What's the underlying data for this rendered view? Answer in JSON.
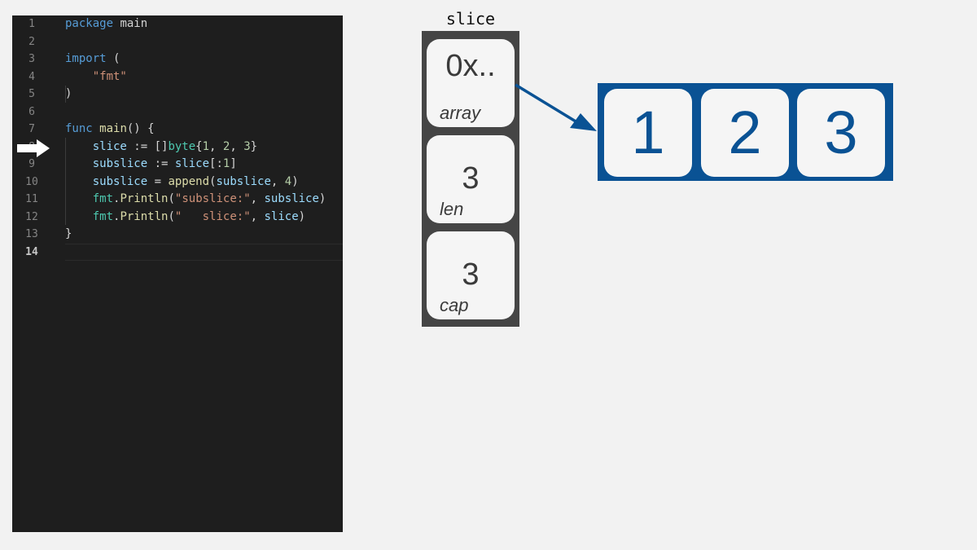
{
  "editor": {
    "current_line": 8,
    "lines": [
      {
        "n": "1",
        "tokens": [
          {
            "t": "package",
            "c": "kw"
          },
          {
            "t": " main",
            "c": "pc"
          }
        ]
      },
      {
        "n": "2",
        "tokens": []
      },
      {
        "n": "3",
        "tokens": [
          {
            "t": "import",
            "c": "kw"
          },
          {
            "t": " (",
            "c": "pc"
          }
        ]
      },
      {
        "n": "4",
        "tokens": [
          {
            "t": "    ",
            "c": "pc"
          },
          {
            "t": "\"fmt\"",
            "c": "str"
          }
        ]
      },
      {
        "n": "5",
        "tokens": [
          {
            "t": ")",
            "c": "pc"
          }
        ]
      },
      {
        "n": "6",
        "tokens": []
      },
      {
        "n": "7",
        "tokens": [
          {
            "t": "func",
            "c": "kw"
          },
          {
            "t": " ",
            "c": "pc"
          },
          {
            "t": "main",
            "c": "fn"
          },
          {
            "t": "() {",
            "c": "pc"
          }
        ]
      },
      {
        "n": "8",
        "tokens": [
          {
            "t": "    ",
            "c": "pc"
          },
          {
            "t": "slice",
            "c": "id"
          },
          {
            "t": " := []",
            "c": "pc"
          },
          {
            "t": "byte",
            "c": "ty"
          },
          {
            "t": "{",
            "c": "pc"
          },
          {
            "t": "1",
            "c": "num"
          },
          {
            "t": ", ",
            "c": "pc"
          },
          {
            "t": "2",
            "c": "num"
          },
          {
            "t": ", ",
            "c": "pc"
          },
          {
            "t": "3",
            "c": "num"
          },
          {
            "t": "}",
            "c": "pc"
          }
        ]
      },
      {
        "n": "9",
        "tokens": [
          {
            "t": "    ",
            "c": "pc"
          },
          {
            "t": "subslice",
            "c": "id"
          },
          {
            "t": " := ",
            "c": "pc"
          },
          {
            "t": "slice",
            "c": "id"
          },
          {
            "t": "[:",
            "c": "pc"
          },
          {
            "t": "1",
            "c": "num"
          },
          {
            "t": "]",
            "c": "pc"
          }
        ]
      },
      {
        "n": "10",
        "tokens": [
          {
            "t": "    ",
            "c": "pc"
          },
          {
            "t": "subslice",
            "c": "id"
          },
          {
            "t": " = ",
            "c": "pc"
          },
          {
            "t": "append",
            "c": "fn"
          },
          {
            "t": "(",
            "c": "pc"
          },
          {
            "t": "subslice",
            "c": "id"
          },
          {
            "t": ", ",
            "c": "pc"
          },
          {
            "t": "4",
            "c": "num"
          },
          {
            "t": ")",
            "c": "pc"
          }
        ]
      },
      {
        "n": "11",
        "tokens": [
          {
            "t": "    ",
            "c": "pc"
          },
          {
            "t": "fmt",
            "c": "ty"
          },
          {
            "t": ".",
            "c": "pc"
          },
          {
            "t": "Println",
            "c": "fn"
          },
          {
            "t": "(",
            "c": "pc"
          },
          {
            "t": "\"subslice:\"",
            "c": "str"
          },
          {
            "t": ", ",
            "c": "pc"
          },
          {
            "t": "subslice",
            "c": "id"
          },
          {
            "t": ")",
            "c": "pc"
          }
        ]
      },
      {
        "n": "12",
        "tokens": [
          {
            "t": "    ",
            "c": "pc"
          },
          {
            "t": "fmt",
            "c": "ty"
          },
          {
            "t": ".",
            "c": "pc"
          },
          {
            "t": "Println",
            "c": "fn"
          },
          {
            "t": "(",
            "c": "pc"
          },
          {
            "t": "\"   slice:\"",
            "c": "str"
          },
          {
            "t": ", ",
            "c": "pc"
          },
          {
            "t": "slice",
            "c": "id"
          },
          {
            "t": ")",
            "c": "pc"
          }
        ]
      },
      {
        "n": "13",
        "tokens": [
          {
            "t": "}",
            "c": "pc"
          }
        ]
      },
      {
        "n": "14",
        "tokens": []
      }
    ]
  },
  "slice": {
    "title": "slice",
    "fields": [
      {
        "value": "0x..",
        "label": "array"
      },
      {
        "value": "3",
        "label": "len"
      },
      {
        "value": "3",
        "label": "cap"
      }
    ]
  },
  "array": {
    "cells": [
      "1",
      "2",
      "3"
    ]
  },
  "colors": {
    "editor_bg": "#1e1e1e",
    "slice_frame": "#454545",
    "array_frame": "#0a5294",
    "pointer": "#0a5294",
    "exec_arrow": "#ffffff"
  }
}
